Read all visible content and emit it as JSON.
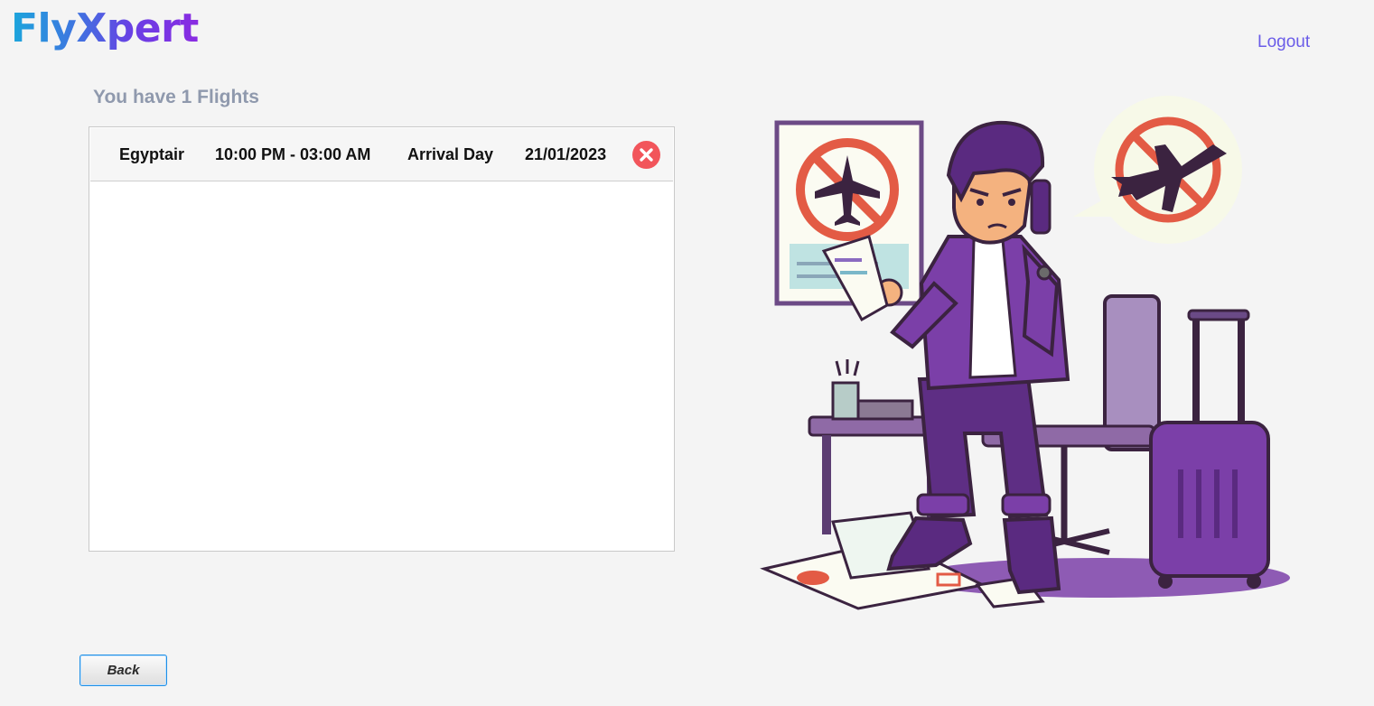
{
  "app": {
    "logo": "FlyXpert",
    "logout_label": "Logout"
  },
  "flights": {
    "heading": "You have 1 Flights",
    "rows": [
      {
        "airline": "Egyptair",
        "time": "10:00 PM - 03:00 AM",
        "day_label": "Arrival Day",
        "date": "21/01/2023"
      }
    ]
  },
  "footer": {
    "back_label": "Back"
  },
  "colors": {
    "accent": "#6a5ce8",
    "heading": "#8f99ad",
    "delete": "#f2555b",
    "illustration_purple": "#7b3fa8"
  },
  "icons": {
    "delete": "close-circle-icon",
    "illustration": "cancelled-flight-illustration"
  }
}
